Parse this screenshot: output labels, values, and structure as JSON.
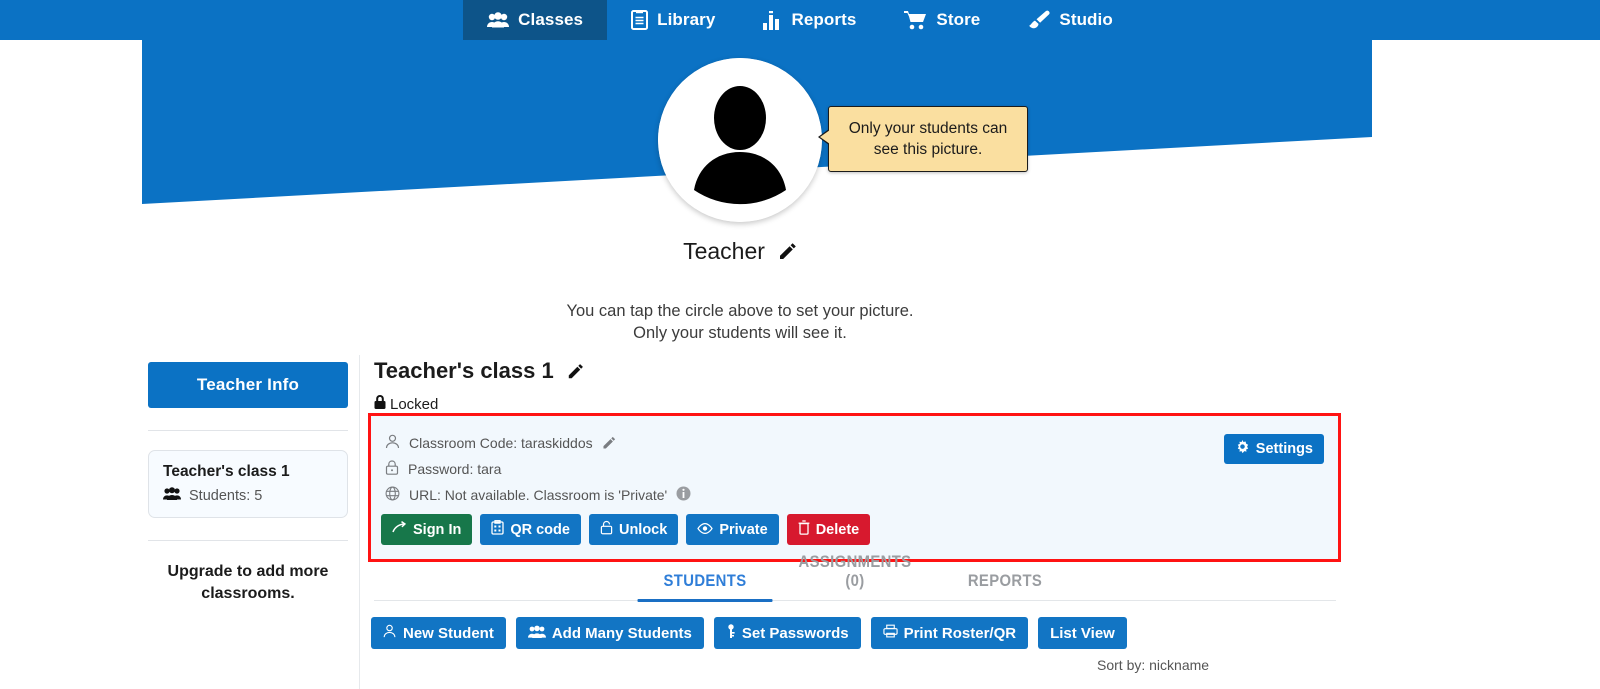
{
  "nav": {
    "items": [
      {
        "label": "Classes",
        "icon": "people-icon",
        "active": true
      },
      {
        "label": "Library",
        "icon": "book-icon",
        "active": false
      },
      {
        "label": "Reports",
        "icon": "bar-chart-icon",
        "active": false
      },
      {
        "label": "Store",
        "icon": "shopping-cart-icon",
        "active": false
      },
      {
        "label": "Studio",
        "icon": "paintbrush-icon",
        "active": false
      }
    ]
  },
  "profile": {
    "tooltip": "Only your students can see this picture.",
    "name": "Teacher",
    "help_line1": "You can tap the circle above to set your picture.",
    "help_line2": "Only your students will see it."
  },
  "sidebar": {
    "teacher_info_label": "Teacher Info",
    "class_card": {
      "name": "Teacher's class 1",
      "students_label": "Students: 5"
    },
    "upgrade_text": "Upgrade to add more classrooms."
  },
  "class": {
    "title": "Teacher's class 1",
    "locked_label": "Locked",
    "info": [
      {
        "icon": "person-icon",
        "text": "Classroom Code: taraskiddos",
        "editable": true
      },
      {
        "icon": "padlock-icon",
        "text": "Password: tara",
        "editable": false
      },
      {
        "icon": "globe-icon",
        "text": "URL: Not available. Classroom is 'Private'",
        "info": true
      }
    ],
    "settings_label": "Settings",
    "actions": [
      {
        "label": "Sign In",
        "icon": "sign-in-icon",
        "color": "green"
      },
      {
        "label": "QR code",
        "icon": "qr-clipboard-icon",
        "color": "blue"
      },
      {
        "label": "Unlock",
        "icon": "padlock-open-icon",
        "color": "blue"
      },
      {
        "label": "Private",
        "icon": "eye-icon",
        "color": "blue"
      },
      {
        "label": "Delete",
        "icon": "trash-icon",
        "color": "red"
      }
    ]
  },
  "tabs": [
    {
      "label": "STUDENTS",
      "active": true
    },
    {
      "label": "ASSIGNMENTS (0)",
      "active": false
    },
    {
      "label": "REPORTS",
      "active": false
    }
  ],
  "student_actions": [
    {
      "label": "New Student",
      "icon": "person-add-icon"
    },
    {
      "label": "Add Many Students",
      "icon": "people-add-icon"
    },
    {
      "label": "Set Passwords",
      "icon": "key-icon"
    },
    {
      "label": "Print Roster/QR",
      "icon": "printer-icon"
    },
    {
      "label": "List View",
      "icon": null
    }
  ],
  "sort_by": "Sort by: nickname",
  "colors": {
    "nav_blue": "#0b72c4",
    "nav_active": "#0d5489",
    "button_blue": "#1275c4",
    "green": "#17774a",
    "red": "#d7192e",
    "highlight_red": "#ff1313",
    "tooltip_yellow": "#fadfa0",
    "tab_active": "#2f7ed8"
  }
}
